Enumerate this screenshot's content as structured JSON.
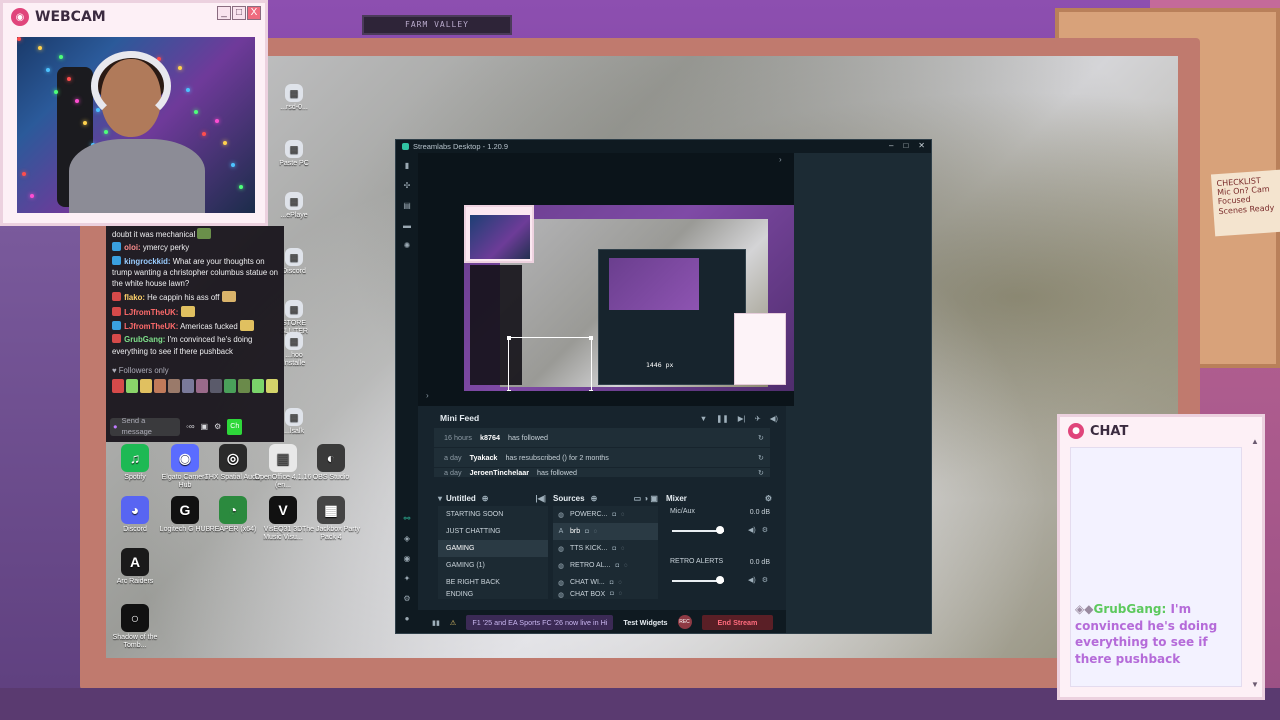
{
  "backdrop": {
    "plaque_text": "FARM VALLEY",
    "note_text": "CHECKLIST Mic On? Cam Focused Scenes Ready"
  },
  "webcam": {
    "title": "WEBCAM",
    "minimize": "_",
    "maximize": "□",
    "close": "X"
  },
  "left_chat": {
    "messages": [
      {
        "user": "",
        "text": "doubt it was mechanical"
      },
      {
        "user": "oloi:",
        "text": "ymercy perky"
      },
      {
        "user": "kingrockkid:",
        "text": "What are your thoughts on trump wanting a christopher columbus statue on the white house lawn?"
      },
      {
        "user": "flako:",
        "text": "He cappin his ass off"
      },
      {
        "user": "LJfromTheUK:",
        "text": ""
      },
      {
        "user": "LJfromTheUK:",
        "text": "Americas fucked"
      },
      {
        "user": "GrubGang:",
        "text": "I'm convinced he's doing everything to see if there pushback"
      }
    ],
    "followers_only": "Followers only",
    "send_placeholder": "Send a message",
    "chat_button": "Ch"
  },
  "desktop_icons": [
    {
      "label": "Spotify",
      "color": "#1db954",
      "glyph": "♫"
    },
    {
      "label": "Elgato Camera Hub",
      "color": "#5a6cff",
      "glyph": "◉"
    },
    {
      "label": "THX Spatial Audio",
      "color": "#2a2a2a",
      "glyph": "◎"
    },
    {
      "label": "OpenOffice 4.1.16 (en...",
      "color": "#e8e8e8",
      "glyph": "▤"
    },
    {
      "label": "OBS Studio",
      "color": "#3a3a3a",
      "glyph": "◐"
    },
    {
      "label": "Discord",
      "color": "#5865f2",
      "glyph": "◕"
    },
    {
      "label": "Logitech G HUB",
      "color": "#111111",
      "glyph": "G"
    },
    {
      "label": "REAPER (x64)",
      "color": "#2b8a3e",
      "glyph": "◔"
    },
    {
      "label": "VisEQ31 3D Music Visu...",
      "color": "#111111",
      "glyph": "V"
    },
    {
      "label": "The Jackbox Party Pack 4",
      "color": "#444444",
      "glyph": "▦"
    },
    {
      "label": "Arc Raiders",
      "color": "#1a1a1a",
      "glyph": "A"
    },
    {
      "label": "Shadow of the Tomb...",
      "color": "#111111",
      "glyph": "○"
    }
  ],
  "desktop_partial_labels": [
    "...rsd-0...",
    "Paste PC",
    "...ePlaye",
    "Discord",
    "STORE CLUTER",
    "...hoo Installe",
    "...lsalk"
  ],
  "streamlabs": {
    "title": "Streamlabs Desktop - 1.20.9",
    "sidebar_icons": [
      "editor-icon",
      "themes-icon",
      "store-icon",
      "media-icon",
      "apps-icon"
    ],
    "preview_px_label": "1446 px",
    "mini_feed": {
      "title": "Mini Feed",
      "events": [
        {
          "time": "16 hours",
          "name": "k8764",
          "action": "has followed"
        },
        {
          "time": "a day",
          "name": "Tyakack",
          "action": "has resubscribed () for 2 months"
        },
        {
          "time": "a day",
          "name": "JeroenTinchelaar",
          "action": "has followed"
        }
      ]
    },
    "scenes": {
      "collection": "Untitled",
      "items": [
        "STARTING SOON",
        "JUST CHATTING",
        "GAMING",
        "GAMING (1)",
        "BE RIGHT BACK",
        "ENDING"
      ],
      "active_index": 2
    },
    "sources": {
      "title": "Sources",
      "items": [
        {
          "name": "POWERC...",
          "icon": "◍"
        },
        {
          "name": "brb",
          "icon": "A"
        },
        {
          "name": "TTS KICK...",
          "icon": "◍"
        },
        {
          "name": "RETRO AL...",
          "icon": "◍"
        },
        {
          "name": "CHAT WI...",
          "icon": "◍"
        },
        {
          "name": "CHAT BOX",
          "icon": "◍"
        }
      ],
      "active_index": 1
    },
    "mixer": {
      "title": "Mixer",
      "channels": [
        {
          "name": "Mic/Aux",
          "db": "0.0 dB"
        },
        {
          "name": "RETRO ALERTS",
          "db": "0.0 dB"
        }
      ]
    },
    "footer": {
      "news": "F1 '25 and EA Sports FC '26 now live in Hi",
      "test_widgets": "Test Widgets",
      "rec": "REC",
      "end_stream": "End Stream"
    }
  },
  "right_chat": {
    "title": "CHAT",
    "user": "GrubGang:",
    "message": "I'm convinced he's doing everything to see if there pushback"
  }
}
